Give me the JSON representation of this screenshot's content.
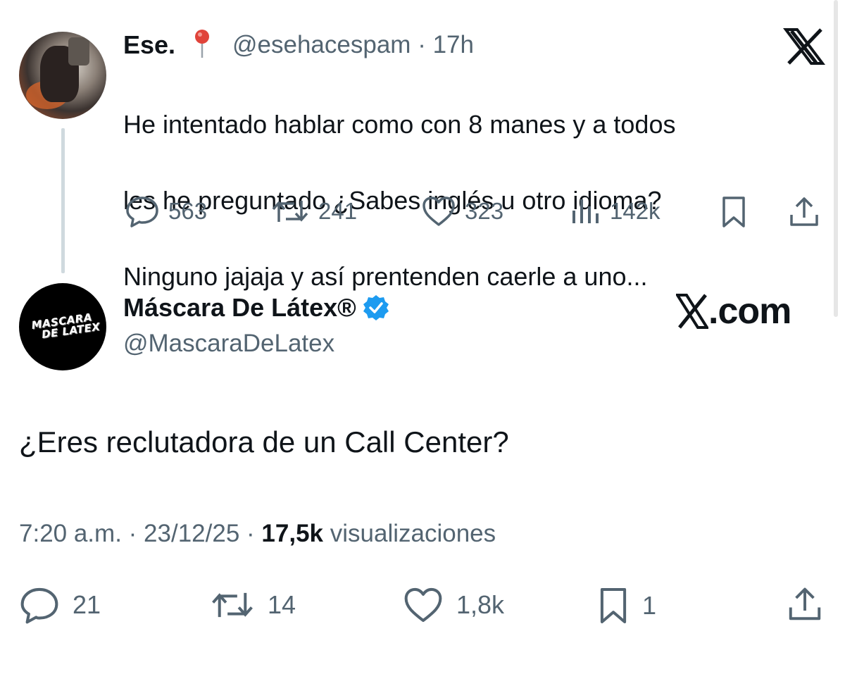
{
  "reply": {
    "display_name": "Ese.",
    "handle": "@esehacespam",
    "separator": "·",
    "time_ago": "17h",
    "lines": [
      "He intentado hablar como con 8 manes y a todos",
      "les he preguntado ¿Sabes inglés u otro idioma?",
      "Ninguno jajaja y así prentenden caerle a uno..."
    ],
    "stats": {
      "replies": "563",
      "reposts": "241",
      "likes": "323",
      "views": "142k"
    }
  },
  "main": {
    "display_name": "Máscara De Látex®",
    "handle": "@MascaraDeLatex",
    "avatar_logo_line1": "MASCARA",
    "avatar_logo_line2": "DE LATEX",
    "text": "¿Eres reclutadora de un Call Center?",
    "time": "7:20 a.m.",
    "sep1": "·",
    "date": "23/12/25",
    "sep2": "·",
    "views_count": "17,5k",
    "views_label": "visualizaciones",
    "stats": {
      "replies": "21",
      "reposts": "14",
      "likes": "1,8k",
      "bookmarks": "1"
    }
  },
  "watermark": {
    "xcom_text": ".com"
  },
  "icons": {
    "reply": "reply-icon",
    "repost": "repost-icon",
    "like": "heart-icon",
    "views": "views-icon",
    "bookmark": "bookmark-icon",
    "share": "share-icon",
    "verified": "verified-badge-icon",
    "pin": "pin-emoji-icon",
    "x_logo": "x-logo-icon"
  },
  "colors": {
    "text": "#0f1419",
    "muted": "#536471",
    "verified": "#1d9bf0",
    "thread_line": "#cfd9de"
  }
}
